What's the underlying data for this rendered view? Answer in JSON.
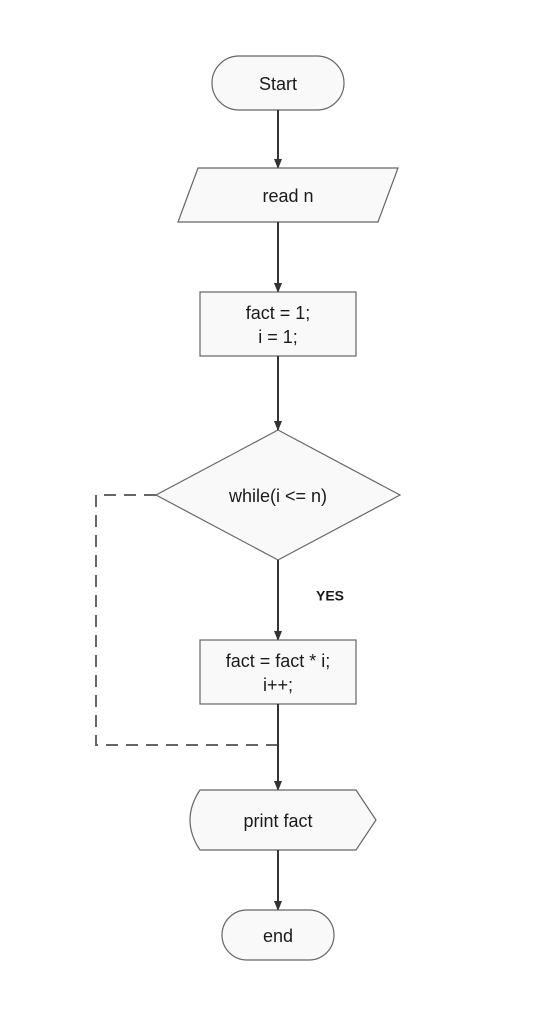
{
  "flowchart": {
    "start": "Start",
    "read": "read n",
    "init_line1": "fact = 1;",
    "init_line2": "i = 1;",
    "decision": "while(i <= n)",
    "yes_label": "YES",
    "loop_line1": "fact = fact * i;",
    "loop_line2": "i++;",
    "output": "print fact",
    "end": "end"
  }
}
